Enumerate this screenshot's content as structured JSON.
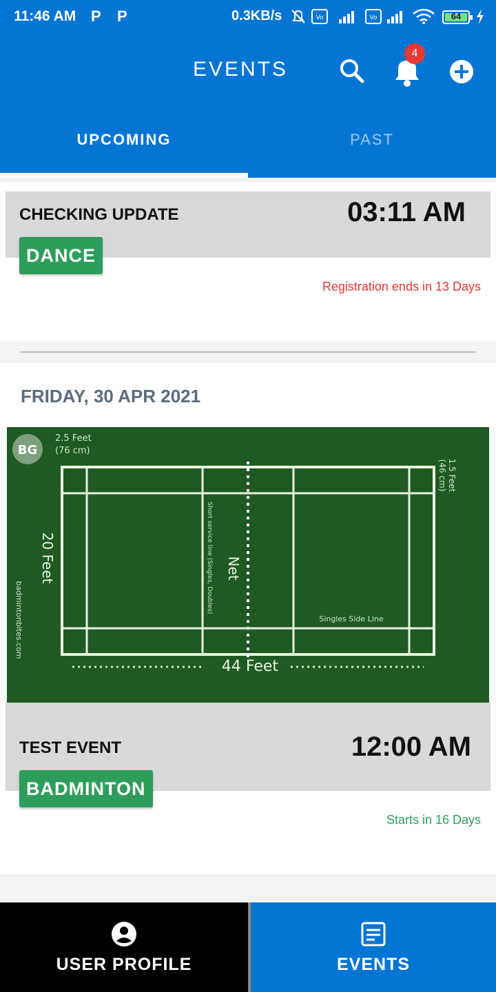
{
  "status_bar": {
    "time": "11:46 AM",
    "notif_icons": [
      "P",
      "P"
    ],
    "net_speed": "0.3KB/s",
    "battery_level": "64"
  },
  "app_bar": {
    "title": "EVENTS",
    "notification_count": "4",
    "icons": [
      "search-icon",
      "bell-icon",
      "add-circle-icon"
    ]
  },
  "tabs": [
    {
      "label": "UPCOMING",
      "active": true
    },
    {
      "label": "PAST",
      "active": false
    }
  ],
  "events": [
    {
      "name": "CHECKING UPDATE",
      "time": "03:11 AM",
      "category": "DANCE",
      "note": "Registration ends in 13 Days",
      "note_color": "#e53935"
    },
    {
      "date_header": "FRIDAY, 30 APR 2021",
      "name": "TEST EVENT",
      "time": "12:00 AM",
      "category": "BADMINTON",
      "note": "Starts in 16 Days",
      "note_color": "#2e9d5c",
      "image": {
        "logo_text": "BG",
        "top_label_1": "2.5 Feet",
        "top_label_2": "(76 cm)",
        "side_label_1": "1.5 Feet",
        "side_label_2": "(46 cm)",
        "width_label": "20 Feet",
        "length_label": "44 Feet",
        "net_label": "Net",
        "service_label": "Short service line (Singles, Doubles)",
        "singles_label": "Singles Side Line",
        "site_label": "badmintonbites.com"
      }
    }
  ],
  "bottom_nav": [
    {
      "label": "USER PROFILE",
      "icon": "account-circle-icon",
      "active": false
    },
    {
      "label": "EVENTS",
      "icon": "event-note-icon",
      "active": true
    }
  ],
  "colors": {
    "primary": "#0575d4",
    "tag_green": "#2e9d5c",
    "court_green": "#1f5a22"
  }
}
